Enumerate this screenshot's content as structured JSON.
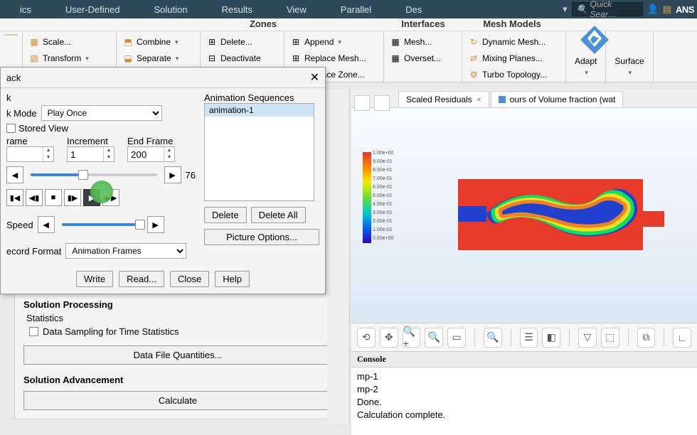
{
  "menu": {
    "items": [
      "ics",
      "User-Defined",
      "Solution",
      "Results",
      "View",
      "Parallel",
      "Des"
    ],
    "search_placeholder": "Quick Sear…",
    "brand": "ANS"
  },
  "ribbon": {
    "zones_title": "Zones",
    "interfaces_title": "Interfaces",
    "mesh_title": "Mesh Models",
    "g1": {
      "scale": "Scale...",
      "transform": "Transform"
    },
    "g2": {
      "combine": "Combine",
      "separate": "Separate"
    },
    "g3": {
      "delete": "Delete...",
      "deactivate": "Deactivate"
    },
    "g4": {
      "append": "Append",
      "replace_mesh": "Replace Mesh...",
      "replace_zone": "Replace Zone..."
    },
    "g5": {
      "mesh": "Mesh...",
      "overset": "Overset..."
    },
    "g6": {
      "dynamic": "Dynamic Mesh...",
      "mixing": "Mixing Planes...",
      "turbo": "Turbo Topology..."
    },
    "adapt": "Adapt",
    "surface": "Surface"
  },
  "dialog": {
    "title": "ack",
    "sub": "k",
    "mode_label": "k Mode",
    "mode_value": "Play Once",
    "stored_view": "Stored View",
    "frame_label": "rame",
    "increment_label": "Increment",
    "endframe_label": "End Frame",
    "frame_val": "",
    "increment_val": "1",
    "endframe_val": "200",
    "slider_value": "76",
    "speed_label": "Speed",
    "record_label": "ecord Format",
    "record_value": "Animation Frames",
    "anim_seq_label": "Animation Sequences",
    "anim_item": "animation-1",
    "delete": "Delete",
    "delete_all": "Delete All",
    "picture_opts": "Picture Options...",
    "write": "Write",
    "read": "Read...",
    "close": "Close",
    "help": "Help"
  },
  "task": {
    "proc_title": "Solution Processing",
    "stats": "Statistics",
    "sampling": "Data Sampling for Time Statistics",
    "dfq": "Data File Quantities...",
    "adv_title": "Solution Advancement",
    "calc": "Calculate"
  },
  "graphics": {
    "tab1": "Scaled Residuals",
    "tab2": "ours of Volume fraction (wat",
    "cb_labels": [
      "1.00e+00",
      "9.00e-01",
      "8.00e-01",
      "7.00e-01",
      "6.00e-01",
      "5.00e-01",
      "4.00e-01",
      "3.00e-01",
      "2.00e-01",
      "1.00e-01",
      "0.00e+00"
    ]
  },
  "console": {
    "title": "Console",
    "lines": [
      "   mp-1",
      "   mp-2",
      "Done.",
      "",
      "Calculation complete."
    ]
  }
}
